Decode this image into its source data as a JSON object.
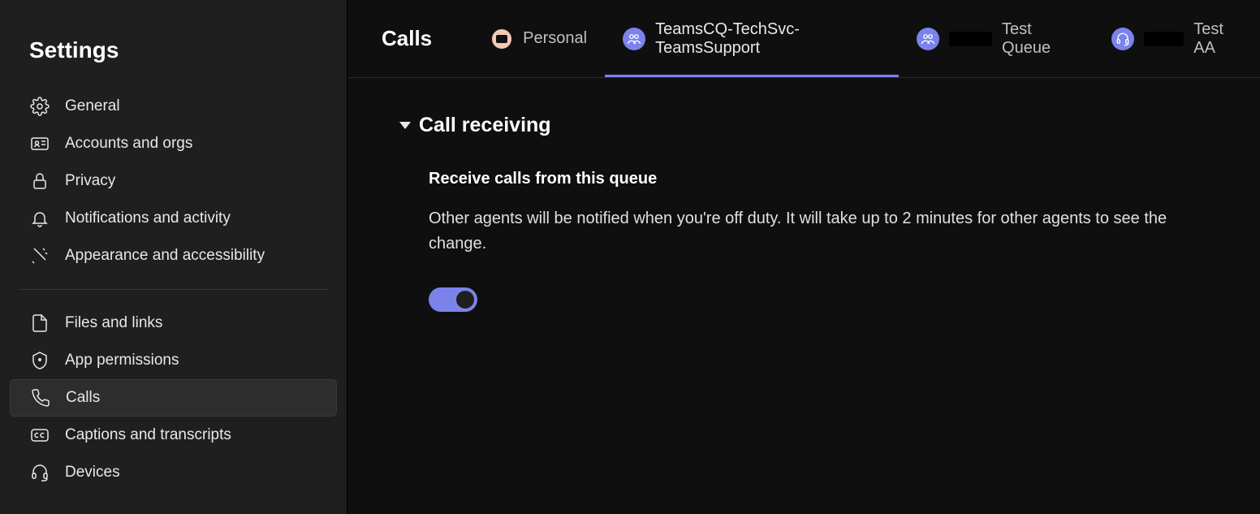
{
  "sidebar": {
    "title": "Settings",
    "group1": [
      {
        "label": "General",
        "icon": "gear"
      },
      {
        "label": "Accounts and orgs",
        "icon": "id-card"
      },
      {
        "label": "Privacy",
        "icon": "lock"
      },
      {
        "label": "Notifications and activity",
        "icon": "bell"
      },
      {
        "label": "Appearance and accessibility",
        "icon": "sparkle"
      }
    ],
    "group2": [
      {
        "label": "Files and links",
        "icon": "file"
      },
      {
        "label": "App permissions",
        "icon": "shield"
      },
      {
        "label": "Calls",
        "icon": "phone",
        "active": true
      },
      {
        "label": "Captions and transcripts",
        "icon": "cc"
      },
      {
        "label": "Devices",
        "icon": "headset"
      }
    ]
  },
  "topbar": {
    "title": "Calls",
    "tabs": [
      {
        "label": "Personal",
        "avatar": "personal"
      },
      {
        "label": "TeamsCQ-TechSvc-TeamsSupport",
        "avatar": "queue",
        "active": true
      },
      {
        "label": "Test Queue",
        "avatar": "queue",
        "redacted": true
      },
      {
        "label": "Test AA",
        "avatar": "headset",
        "redacted": true
      }
    ]
  },
  "content": {
    "section_title": "Call receiving",
    "setting_title": "Receive calls from this queue",
    "setting_desc": "Other agents will be notified when you're off duty. It will take up to 2 minutes for other agents to see the change.",
    "toggle_on": true
  }
}
